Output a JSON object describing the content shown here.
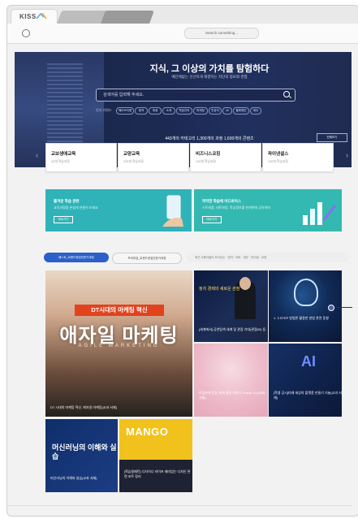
{
  "browser": {
    "logo": "KISS",
    "search_url": "Search something..."
  },
  "hero": {
    "title": "지식, 그 이상의 가치를 탐험하다",
    "subtitle": "예단에없는 신선하게 해결하는 차단의 정보와 경험",
    "search_placeholder": "검색어를 입력해 주세요.",
    "keyword_label": "인기 키워드",
    "keywords": [
      "웨이브티켓",
      "합격",
      "재생",
      "소개",
      "학습관리",
      "마케팅",
      "인공지",
      "AI",
      "블록체인",
      "재무"
    ],
    "counts": "443개의 카테고리 1,300개의 과정 1,600개의 콘텐츠",
    "all_button": "전체보기"
  },
  "categories": [
    {
      "title": "교보생애교육",
      "sub": "26개 학습과정"
    },
    {
      "title": "교양교육",
      "sub": "226개 학습과정"
    },
    {
      "title": "비즈니스코칭",
      "sub": "126개 학습과정"
    },
    {
      "title": "파이낸셜스",
      "sub": "126개 학습과정"
    }
  ],
  "banners": [
    {
      "title": "즐겨운 학습 관련",
      "desc": "교육과정을 손쉽게 만들어 보세요",
      "button": "바로가기",
      "color": "#2fb3b9"
    },
    {
      "title": "막막한 학습에 어드바이스",
      "desc": "스트레칭, 네트워킹, 학습정보를 한꺼번에 공유하여",
      "button": "바로가기",
      "color": "#33b9b2"
    }
  ],
  "filters": {
    "active": "베스트_트렌드현업전문가과정",
    "second": "프리미엄_트렌드현업전문가과정",
    "rest": "최근 사용자들이 보고있는 · 영어 · 자바 · 재무 · 리더쉽 · 교양"
  },
  "tiles": {
    "big": {
      "badge": "DT시대의 마케팅 혁신",
      "headline": "애자일 마케팅",
      "sub": "AGILE MARKETING",
      "caption": "DT 시대의 마케팅 혁신, 애자일 마케팅(교과 서재)"
    },
    "t2": {
      "text": "정치 경제의 새로운 관점",
      "caption": "[세계에서] 공연탐색 세계 및 관점 기대(관점02) 등"
    },
    "t3": {
      "caption": "1. 3 STEP 방법론 활용한 방법 관련 동향"
    },
    "t4": {
      "caption": "모임손에 맞은 세계 열린 이야기 Oracle 12c(교과 서재)"
    },
    "t5": {
      "caption": "[학생 공시]미래 세상의 플랫폼 만들기 기술(교과 서재)"
    },
    "t6": {
      "headline": "머신러닝의 이해와 실습",
      "caption": "머신러닝의 이해와 실습(교과 서재)"
    },
    "t7": {
      "headline": "MANGO",
      "caption": "[학습용패턴] 디자이너 라이프 재미있는 디자인 관련 포트 정리"
    }
  }
}
